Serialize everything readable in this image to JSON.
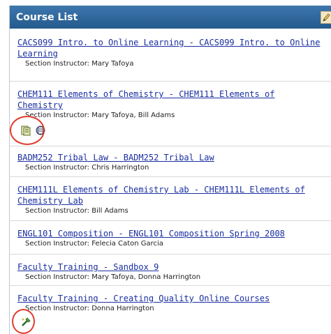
{
  "header": {
    "title": "Course List",
    "edit_icon": "pencil-icon"
  },
  "courses": [
    {
      "title": "CACS099 Intro. to Online Learning - CACS099 Intro. to Online Learning",
      "instructor": "Section Instructor: Mary Tafoya"
    },
    {
      "title": "CHEM111 Elements of Chemistry - CHEM111 Elements of Chemistry",
      "instructor": "Section Instructor: Mary Tafoya, Bill Adams",
      "icons": [
        "gradebook-icon",
        "tools-icon"
      ]
    },
    {
      "title": "BADM252 Tribal Law - BADM252 Tribal Law",
      "instructor": "Section Instructor: Chris Harrington"
    },
    {
      "title": "CHEM111L Elements of Chemistry Lab - CHEM111L Elements of Chemistry Lab",
      "instructor": "Section Instructor: Bill Adams"
    },
    {
      "title": "ENGL101 Composition - ENGL101 Composition Spring 2008",
      "instructor": "Section Instructor: Felecia Caton Garcia"
    },
    {
      "title": "Faculty Training - Sandbox 9",
      "instructor": "Section Instructor: Mary Tafoya, Donna Harrington"
    },
    {
      "title": "Faculty Training - Creating Quality Online Courses",
      "instructor": "Section Instructor: Donna Harrington",
      "icons": [
        "tools-wand-icon"
      ]
    }
  ],
  "colors": {
    "header_bg": "#2e6aa1",
    "link": "#1a2fa0",
    "highlight_circle": "#e23c2c"
  }
}
